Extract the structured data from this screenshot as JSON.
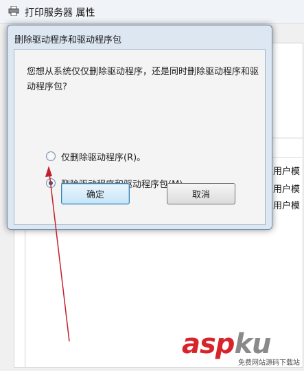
{
  "background_window": {
    "title": "打印服务器 属性",
    "list_cells": [
      "用户模",
      "用户模",
      "用户模"
    ]
  },
  "dialog": {
    "title": "删除驱动程序和驱动程序包",
    "question": "您想从系统仅仅删除驱动程序，还是同时删除驱动程序和驱动程序包?",
    "options": [
      {
        "label": "仅删除驱动程序(R)。",
        "selected": false
      },
      {
        "label": "删除驱动程序和驱动程序包(M)。",
        "selected": true
      }
    ],
    "ok_label": "确定",
    "cancel_label": "取消"
  },
  "watermark": {
    "logo_main": "asp",
    "logo_accent": "ku",
    "subtitle": "免费网站源码下载站"
  },
  "colors": {
    "annotation_arrow": "#c0202a",
    "dialog_frame": "#6d8db4",
    "watermark_red": "#d8232a"
  }
}
